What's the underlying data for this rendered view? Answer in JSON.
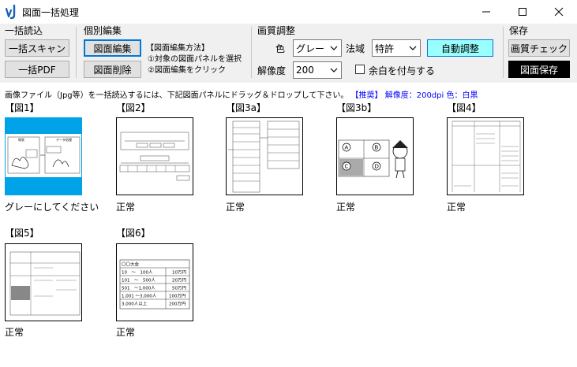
{
  "window": {
    "title": "図面一括処理",
    "controls": [
      "minimize",
      "maximize",
      "close"
    ]
  },
  "toolbar": {
    "bulk_load": {
      "title": "一括読込",
      "scan_button": "一括スキャン",
      "pdf_button": "一括PDF"
    },
    "individual_edit": {
      "title": "個別編集",
      "edit_button": "図面編集",
      "delete_button": "図面削除",
      "method_title": "【図面編集方法】",
      "method_step1": "①対象の図面パネルを選択",
      "method_step2": "②図面編集をクリック"
    },
    "quality": {
      "title": "画質調整",
      "color_label": "色",
      "color_value": "グレー",
      "law_label": "法域",
      "law_value": "特許",
      "auto_button": "自動調整",
      "resolution_label": "解像度",
      "resolution_value": "200",
      "margin_label": "余白を付与する",
      "margin_checked": false,
      "auto_button_color": "#99ffff"
    },
    "save": {
      "title": "保存",
      "check_button": "画質チェック",
      "save_button": "図面保存"
    }
  },
  "instruction": {
    "text": "画像ファイル（Jpg等）を一括読込するには、下記図面パネルにドラッグ＆ドロップして下さい。",
    "recommend": "【推奨】 解像度：200dpi 色：白黒"
  },
  "panels": [
    {
      "label": "【図1】",
      "status": "グレーにしてください",
      "selected": true
    },
    {
      "label": "【図2】",
      "status": "正常",
      "selected": false
    },
    {
      "label": "【図3a】",
      "status": "正常",
      "selected": false
    },
    {
      "label": "【図3b】",
      "status": "正常",
      "selected": false
    },
    {
      "label": "【図4】",
      "status": "正常",
      "selected": false
    },
    {
      "label": "【図5】",
      "status": "正常",
      "selected": false
    },
    {
      "label": "【図6】",
      "status": "正常",
      "selected": false
    }
  ],
  "fig6_table": {
    "header": "〇〇大会",
    "rows": [
      [
        "10　〜　100人",
        "10万円"
      ],
      [
        "101　〜　500人",
        "20万円"
      ],
      [
        "501　〜1,000人",
        "50万円"
      ],
      [
        "1,001 〜3,000人",
        "100万円"
      ],
      [
        "3,000人以上",
        "200万円"
      ]
    ]
  },
  "fig3b_labels": [
    "A",
    "B",
    "C",
    "D"
  ],
  "fig1_captions": [
    "現状",
    "データ処理"
  ]
}
